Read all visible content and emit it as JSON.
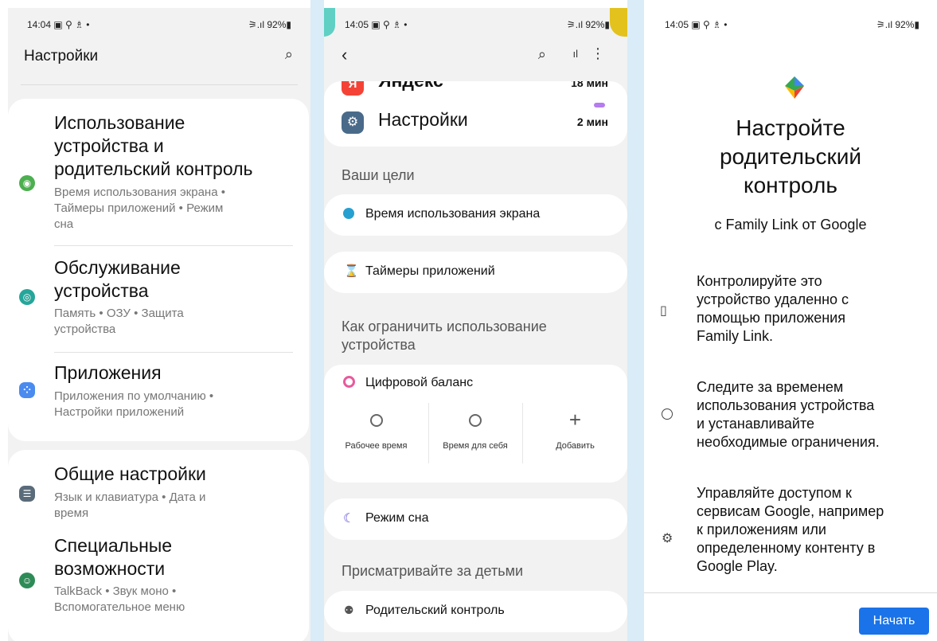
{
  "screen1": {
    "status": {
      "time_icons": "14:04 ▣ ⚲ ♗ •",
      "battery": "⚞.ıl 92%▮"
    },
    "header": {
      "title": "Настройки"
    },
    "items": [
      {
        "title": "Использование устройства и родительский контроль",
        "title_l1": "Использование",
        "title_l2": "устройства и",
        "title_l3": "родительский контроль",
        "sub_l1": "Время использования экрана •",
        "sub_l2": "Таймеры приложений • Режим",
        "sub_l3": "сна",
        "color": "#4caf50"
      },
      {
        "title_l1": "Обслуживание",
        "title_l2": "устройства",
        "sub_l1": "Память • ОЗУ • Защита",
        "sub_l2": "устройства",
        "color": "#26a69a"
      },
      {
        "title_l1": "Приложения",
        "sub_l1": "Приложения по умолчанию •",
        "sub_l2": "Настройки приложений",
        "color": "#4a8bef"
      },
      {
        "title_l1": "Общие настройки",
        "sub_l1": "Язык и клавиатура • Дата и",
        "sub_l2": "время",
        "color": "#5a6b7a"
      },
      {
        "title_l1": "Специальные",
        "title_l2": "возможности",
        "sub_l1": "TalkBack • Звук моно •",
        "sub_l2": "Вспомогательное меню",
        "color": "#2e8b57"
      }
    ]
  },
  "screen2": {
    "status": {
      "time_icons": "14:05 ▣ ⚲ ♗ •",
      "battery": "⚞.ıl 92%▮"
    },
    "apps": [
      {
        "name": "Яндекс",
        "time": "18 мин"
      },
      {
        "name": "Настройки",
        "time": "2 мин"
      }
    ],
    "goals_header": "Ваши цели",
    "screen_time": "Время использования экрана",
    "app_timers": "Таймеры приложений",
    "limit_header": "Как ограничить использование устройства",
    "limit_header_l1": "Как ограничить использование",
    "limit_header_l2": "устройства",
    "digital_balance": "Цифровой баланс",
    "modes": [
      {
        "label": "Рабочее время"
      },
      {
        "label": "Время для себя"
      },
      {
        "label": "Добавить"
      }
    ],
    "sleep_mode": "Режим сна",
    "kids_header": "Присматривайте за детьми",
    "parental_control": "Родительский контроль"
  },
  "screen3": {
    "status": {
      "time_icons": "14:05 ▣ ⚲ ♗ •",
      "battery": "⚞.ıl 92%▮"
    },
    "title_l1": "Настройте",
    "title_l2": "родительский",
    "title_l3": "контроль",
    "subtitle": "с Family Link от Google",
    "features": [
      {
        "l1": "Контролируйте это",
        "l2": "устройство удаленно с",
        "l3": "помощью приложения",
        "l4": "Family Link."
      },
      {
        "l1": "Следите за временем",
        "l2": "использования устройства",
        "l3": "и устанавливайте",
        "l4": "необходимые ограничения."
      },
      {
        "l1": "Управляйте доступом к",
        "l2": "сервисам Google, например",
        "l3": "к приложениям или",
        "l4": "определенному контенту в",
        "l5": "Google Play."
      }
    ],
    "start_button": "Начать",
    "accent": "#1a73e8"
  }
}
